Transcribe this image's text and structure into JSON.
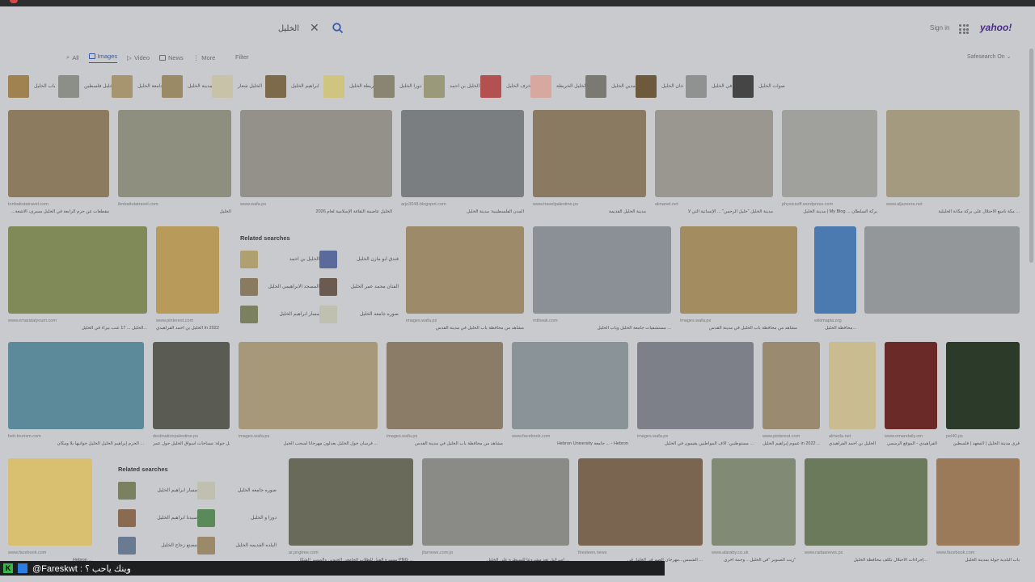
{
  "search": {
    "query": "الخليل",
    "clear_icon": "close-icon",
    "button_icon": "search-icon"
  },
  "header": {
    "signin": "Sign in",
    "logo": "yahoo!"
  },
  "tabs": [
    {
      "label": "All",
      "icon": "search-icon"
    },
    {
      "label": "Images",
      "icon": "image-icon",
      "active": true
    },
    {
      "label": "Video",
      "icon": "play-icon"
    },
    {
      "label": "News",
      "icon": "news-icon"
    },
    {
      "label": "More",
      "icon": "more-icon"
    }
  ],
  "filter": "Filter",
  "safesearch": "Safesearch On",
  "pills": [
    {
      "text": "باب الخليل",
      "color": "#a08250"
    },
    {
      "text": "الخليل فلسطين",
      "color": "#8c8f88"
    },
    {
      "text": "جامعة الخليل",
      "color": "#a79570"
    },
    {
      "text": "مدينة الخليل",
      "color": "#9a8a66"
    },
    {
      "text": "الخليل شعار",
      "color": "#c7c2a8"
    },
    {
      "text": "ابراهيم الخليل",
      "color": "#7d6a4a"
    },
    {
      "text": "خريطة الخليل",
      "color": "#cfc480"
    },
    {
      "text": "دورا الخليل",
      "color": "#8a8570"
    },
    {
      "text": "الخليل بن احمد",
      "color": "#9a9a7a"
    },
    {
      "text": "خزف الخليل",
      "color": "#b35050"
    },
    {
      "text": "الخليل الخريطة",
      "color": "#d6a8a0"
    },
    {
      "text": "مدين الخليل",
      "color": "#7a7a72"
    },
    {
      "text": "خان الخليل",
      "color": "#6d5a3c"
    },
    {
      "text": "شهيد في الخليل",
      "color": "#8f9290"
    },
    {
      "text": "صوات الخليل",
      "color": "#454545"
    }
  ],
  "results": [
    {
      "color": "#8d7b60",
      "source": "tonbattutatravel.com",
      "title": "...مقطعات عن حرم الرابعة في الخليل مسرى، الأشعة"
    },
    {
      "color": "#8f8f80",
      "source": "ibnbattutatravel.com",
      "title": "الخليل"
    },
    {
      "color": "#93918a",
      "source": "www.wafa.ps",
      "title": "الخليل عاصمة الثقافة الإسلامية لعام 2026"
    },
    {
      "color": "#7a7e80",
      "source": "arjo3048.blogspot.com",
      "title": "المدن الفلسطينية: مدينة الخليل"
    },
    {
      "color": "#8b7a62",
      "source": "www.travelpalestine.ps",
      "title": "مدينة الخليل القديمة"
    },
    {
      "color": "#9a9790",
      "source": "aknanet.net",
      "title": "مدينة الخليل \"خليل الرحمن\" ... الإنسانية التي لا"
    },
    {
      "color": "#a0a09c",
      "source": "physicsoff.wordpress.com",
      "title": "مدينة الخليل | My Blog ... بركة السلطان"
    },
    {
      "color": "#a39a80",
      "source": "www.aljazeera.net",
      "title": "مكة تاسع الاحتلال على بركة مكانة الخليلية ..."
    },
    {
      "color": "#7f8a58",
      "source": "www.emaratalyoum.com",
      "title": "الخليل ... 17 عنب بيراء في الخليل..."
    },
    {
      "color": "#b89a5a",
      "source": "www.pinterest.com",
      "title": "الخليل بن أحمد الفراهيدي In 2022 ..."
    },
    {
      "color": "#9c8a68",
      "source": "images.wafa.ps",
      "title": "مشاهد من محافظة باب الخليل في مدينة القدس"
    },
    {
      "color": "#8a9096",
      "source": "mtitwak.com",
      "title": "مستشفيات جامعة الخليل وباب الخليل ..."
    },
    {
      "color": "#a38c60",
      "source": "images.wafa.ps",
      "title": "مشاهد من محافظة باب الخليل في مدينة القدس"
    },
    {
      "color": "#4a7ab0",
      "source": "wikimapia.org",
      "title": "محافظة الخليل..."
    },
    {
      "color": "#93979a",
      "source": "",
      "title": ""
    },
    {
      "color": "#5d8a9a",
      "source": "beit-tourism.com",
      "title": "الحرم إبراهيم الخليل الخليل جوانبها بلا ومكان ..."
    },
    {
      "color": "#5a5c54",
      "source": "destinationpalestine.ps",
      "title": "الخليل جولة: مساحات أسواق الخليل جول عمر"
    },
    {
      "color": "#a8987a",
      "source": "images.wafa.ps",
      "title": "فرسان جول الخليل يعدلون مهرجانا لسحب الخيل ..."
    },
    {
      "color": "#8b7c68",
      "source": "images.wafa.ps",
      "title": "مشاهد من محافظة باب الخليل في مدينة القدس"
    },
    {
      "color": "#8a9498",
      "source": "www.facebook.com",
      "title": "Hebron University جامعة ... - Hebron"
    },
    {
      "color": "#7d8088",
      "source": "images.wafa.ps",
      "title": "مستوطنين: ألاف المواطنين يقيمون في الخليل ..."
    },
    {
      "color": "#9a8a70",
      "source": "www.pinterest.com",
      "title": "عموم إبراهيم الخليل in 2022 ..."
    },
    {
      "color": "#c8bc90",
      "source": "almeda.net",
      "title": "الخليل بن أحمد الفراهيدي"
    },
    {
      "color": "#6a2a28",
      "source": "www.omandaily.om",
      "title": "الفراهيدي - الموقع الرسمي"
    },
    {
      "color": "#2c3a2a",
      "source": "pel40.ps",
      "title": "فرى مدينة الخليل | المعهد | فلسطين"
    },
    {
      "color": "#d8c070",
      "source": "www.facebook.com",
      "title": "Hebron ..."
    },
    {
      "color": "#6a6a5a",
      "source": "ar.pngtree.com",
      "title": "مسيرة الفيل للطلاب الجامعي الجنوبي والمسير الشكل PNG ..."
    },
    {
      "color": "#8a8a86",
      "source": "jfarnews.com.jo",
      "title": "إسرائيل تعد مشروعا للسيطرة على الخليل ..."
    },
    {
      "color": "#7a6650",
      "source": "firesteen.news",
      "title": "الشمس...مهرجان الصم في الخليل في ..."
    },
    {
      "color": "#808a74",
      "source": "www.alaraby.co.uk",
      "title": "زيت الصنوبر \"في الخليل .. وجمة أخرى\""
    },
    {
      "color": "#6a7a5a",
      "source": "www.radaanews.ps",
      "title": "إجراءات الاحتلال تكلف محافظة الخليل..."
    },
    {
      "color": "#9a7a58",
      "source": "www.facebook.com",
      "title": "باب البلدية جولة بمدينة الخليل"
    }
  ],
  "related1": {
    "heading": "Related searches",
    "items": [
      {
        "text": "الخليل بن احمد",
        "color": "#b0a070"
      },
      {
        "text": "فندق ابو مازن الخليل",
        "color": "#5a6a9a"
      },
      {
        "text": "المسجد الابراهيمي الخليل",
        "color": "#8a7a60"
      },
      {
        "text": "الفنان محمد عمر الخليل",
        "color": "#6a5a50"
      },
      {
        "text": "مسار ابراهيم الخليل",
        "color": "#7a8060"
      },
      {
        "text": "صوره جامعه الخليل",
        "color": "#c0c0b0"
      }
    ]
  },
  "related2": {
    "heading": "Related searches",
    "items": [
      {
        "text": "مسار ابراهيم الخليل",
        "color": "#7a8060"
      },
      {
        "text": "صوره جامعه الخليل",
        "color": "#c0c0b0"
      },
      {
        "text": "سيدنا ابراهيم الخليل",
        "color": "#8a6a50"
      },
      {
        "text": "دورا و الخليل",
        "color": "#5a8a5a"
      },
      {
        "text": "مصنع زجاج الخليل",
        "color": "#6a7a90"
      },
      {
        "text": "البلده القديمه الخليل",
        "color": "#9a8a6a"
      }
    ]
  },
  "bottom": {
    "label": "@Fareskwt : وينك ياحب ؟",
    "k": "K",
    "url": "https://images.search.yahoo.com/search/images?p=%D8%A7%D9%84%D8%AE%D9%84%D9%8A%D9%84&fr=yfp-t&..."
  }
}
